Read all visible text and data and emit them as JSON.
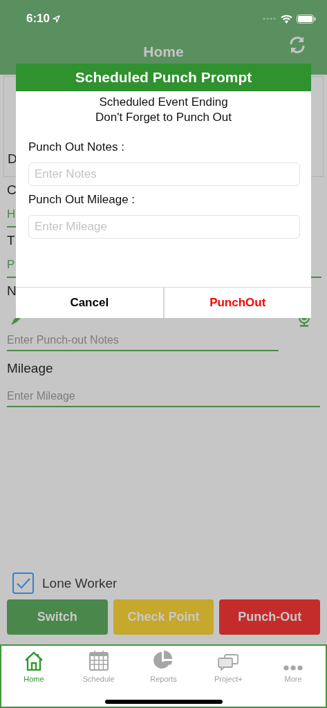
{
  "status_bar": {
    "time": "6:10"
  },
  "header": {
    "title": "Home"
  },
  "background_form": {
    "card_label": "D",
    "fields": [
      {
        "kind": "label",
        "text": "C"
      },
      {
        "kind": "input",
        "text": "H"
      },
      {
        "kind": "label",
        "text": "T"
      },
      {
        "kind": "select",
        "text": "P"
      },
      {
        "kind": "label",
        "text": "N"
      }
    ],
    "notes_placeholder": "Enter Punch-out Notes",
    "mileage_label": "Mileage",
    "mileage_placeholder": "Enter Mileage"
  },
  "dialog": {
    "title": "Scheduled Punch Prompt",
    "message": [
      "Scheduled Event Ending",
      "Don't Forget to Punch Out"
    ],
    "fields": [
      {
        "label": "Punch Out Notes :",
        "placeholder": "Enter Notes"
      },
      {
        "label": "Punch Out Mileage :",
        "placeholder": "Enter Mileage"
      }
    ],
    "buttons": [
      {
        "label": "Cancel",
        "kind": "cancel"
      },
      {
        "label": "PunchOut",
        "kind": "destructive"
      }
    ]
  },
  "lone_worker": {
    "label": "Lone Worker",
    "checked": true
  },
  "actions": [
    {
      "label": "Switch",
      "color": "#4a874a"
    },
    {
      "label": "Check Point",
      "color": "#c5a82c"
    },
    {
      "label": "Punch-Out",
      "color": "#c42c2c"
    }
  ],
  "tabs": [
    {
      "label": "Home",
      "kind": "home",
      "selected": true
    },
    {
      "label": "Schedule",
      "kind": "calendar",
      "selected": false
    },
    {
      "label": "Reports",
      "kind": "pie",
      "selected": false
    },
    {
      "label": "Project+",
      "kind": "chat",
      "selected": false
    },
    {
      "label": "More",
      "kind": "more",
      "selected": false
    }
  ]
}
